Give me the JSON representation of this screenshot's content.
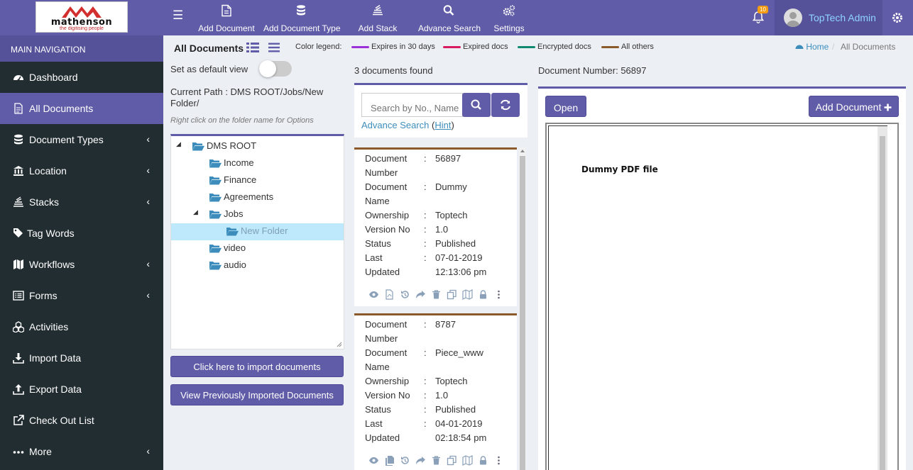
{
  "brand": {
    "name": "mathenson",
    "tagline": "the digitising people"
  },
  "toolbar": {
    "items": [
      {
        "label": "Add Document",
        "icon": "file-icon"
      },
      {
        "label": "Add Document Type",
        "icon": "database-icon"
      },
      {
        "label": "Add Stack",
        "icon": "stack-icon"
      },
      {
        "label": "Advance Search",
        "icon": "search-icon"
      },
      {
        "label": "Settings",
        "icon": "gears-icon"
      }
    ],
    "notification_count": "10",
    "user_name": "TopTech Admin"
  },
  "sidebar": {
    "header": "MAIN NAVIGATION",
    "items": [
      {
        "label": "Dashboard",
        "icon": "dashboard-icon",
        "has_children": false
      },
      {
        "label": "All Documents",
        "icon": "document-icon",
        "has_children": false,
        "active": true
      },
      {
        "label": "Document Types",
        "icon": "database-icon",
        "has_children": true
      },
      {
        "label": "Location",
        "icon": "institution-icon",
        "has_children": true
      },
      {
        "label": "Stacks",
        "icon": "stack-icon",
        "has_children": true
      },
      {
        "label": "Tag Words",
        "icon": "tags-icon",
        "has_children": false
      },
      {
        "label": "Workflows",
        "icon": "map-icon",
        "has_children": true
      },
      {
        "label": "Forms",
        "icon": "list-alt-icon",
        "has_children": true
      },
      {
        "label": "Activities",
        "icon": "cubes-icon",
        "has_children": false
      },
      {
        "label": "Import Data",
        "icon": "download-icon",
        "has_children": false
      },
      {
        "label": "Export Data",
        "icon": "upload-icon",
        "has_children": false
      },
      {
        "label": "Check Out List",
        "icon": "external-link-icon",
        "has_children": false
      },
      {
        "label": "More",
        "icon": "ellipsis-icon",
        "has_children": true
      }
    ]
  },
  "header": {
    "title": "All Documents",
    "legend_title": "Color legend:",
    "legend": [
      {
        "label": "Expires in 30 days",
        "color": "#9b30d9"
      },
      {
        "label": "Expired docs",
        "color": "#d81b60"
      },
      {
        "label": "Encrypted docs",
        "color": "#0f8a6e"
      },
      {
        "label": "All others",
        "color": "#8b5a2b"
      }
    ],
    "breadcrumb": {
      "home": "Home",
      "current": "All Documents"
    }
  },
  "folder_panel": {
    "default_view_label": "Set as default view",
    "default_view_on": false,
    "current_path": "Current Path : DMS ROOT/Jobs/New Folder/",
    "hint": "Right click on the folder name for Options",
    "tree": [
      {
        "label": "DMS ROOT",
        "expanded": true
      },
      {
        "label": "Income"
      },
      {
        "label": "Finance"
      },
      {
        "label": "Agreements"
      },
      {
        "label": "Jobs",
        "expanded": true
      },
      {
        "label": "New Folder",
        "selected": true
      },
      {
        "label": "video"
      },
      {
        "label": "audio"
      }
    ],
    "import_button": "Click here to import documents",
    "view_imported_button": "View Previously Imported Documents"
  },
  "results": {
    "count_text": "3 documents found",
    "search_placeholder": "Search by No., Name",
    "advance_search": "Advance Search",
    "hint_open": "(",
    "hint": "Hint",
    "hint_close": ")",
    "documents": [
      {
        "rows": [
          {
            "label": "Document",
            "sep": ":",
            "value": "56897"
          },
          {
            "label": "Number",
            "sep": "",
            "value": ""
          },
          {
            "label": "Document",
            "sep": ":",
            "value": "Dummy"
          },
          {
            "label": "Name",
            "sep": "",
            "value": ""
          },
          {
            "label": "Ownership",
            "sep": ":",
            "value": "Toptech"
          },
          {
            "label": "Version No",
            "sep": ":",
            "value": "1.0"
          },
          {
            "label": "Status",
            "sep": ":",
            "value": "Published"
          },
          {
            "label": "Last",
            "sep": ":",
            "value": "07-01-2019"
          },
          {
            "label": "Updated",
            "sep": "",
            "value": "12:13:06 pm"
          }
        ]
      },
      {
        "rows": [
          {
            "label": "Document",
            "sep": ":",
            "value": "8787"
          },
          {
            "label": "Number",
            "sep": "",
            "value": ""
          },
          {
            "label": "Document",
            "sep": ":",
            "value": "Piece_www"
          },
          {
            "label": "Name",
            "sep": "",
            "value": ""
          },
          {
            "label": "Ownership",
            "sep": ":",
            "value": "Toptech"
          },
          {
            "label": "Version No",
            "sep": ":",
            "value": "1.0"
          },
          {
            "label": "Status",
            "sep": ":",
            "value": "Published"
          },
          {
            "label": "Last",
            "sep": ":",
            "value": "04-01-2019"
          },
          {
            "label": "Updated",
            "sep": "",
            "value": "02:18:54 pm"
          }
        ]
      }
    ]
  },
  "viewer": {
    "doc_number_label": "Document Number: 56897",
    "open_button": "Open",
    "add_button": "Add Document",
    "pdf_text": "Dummy PDF file"
  }
}
